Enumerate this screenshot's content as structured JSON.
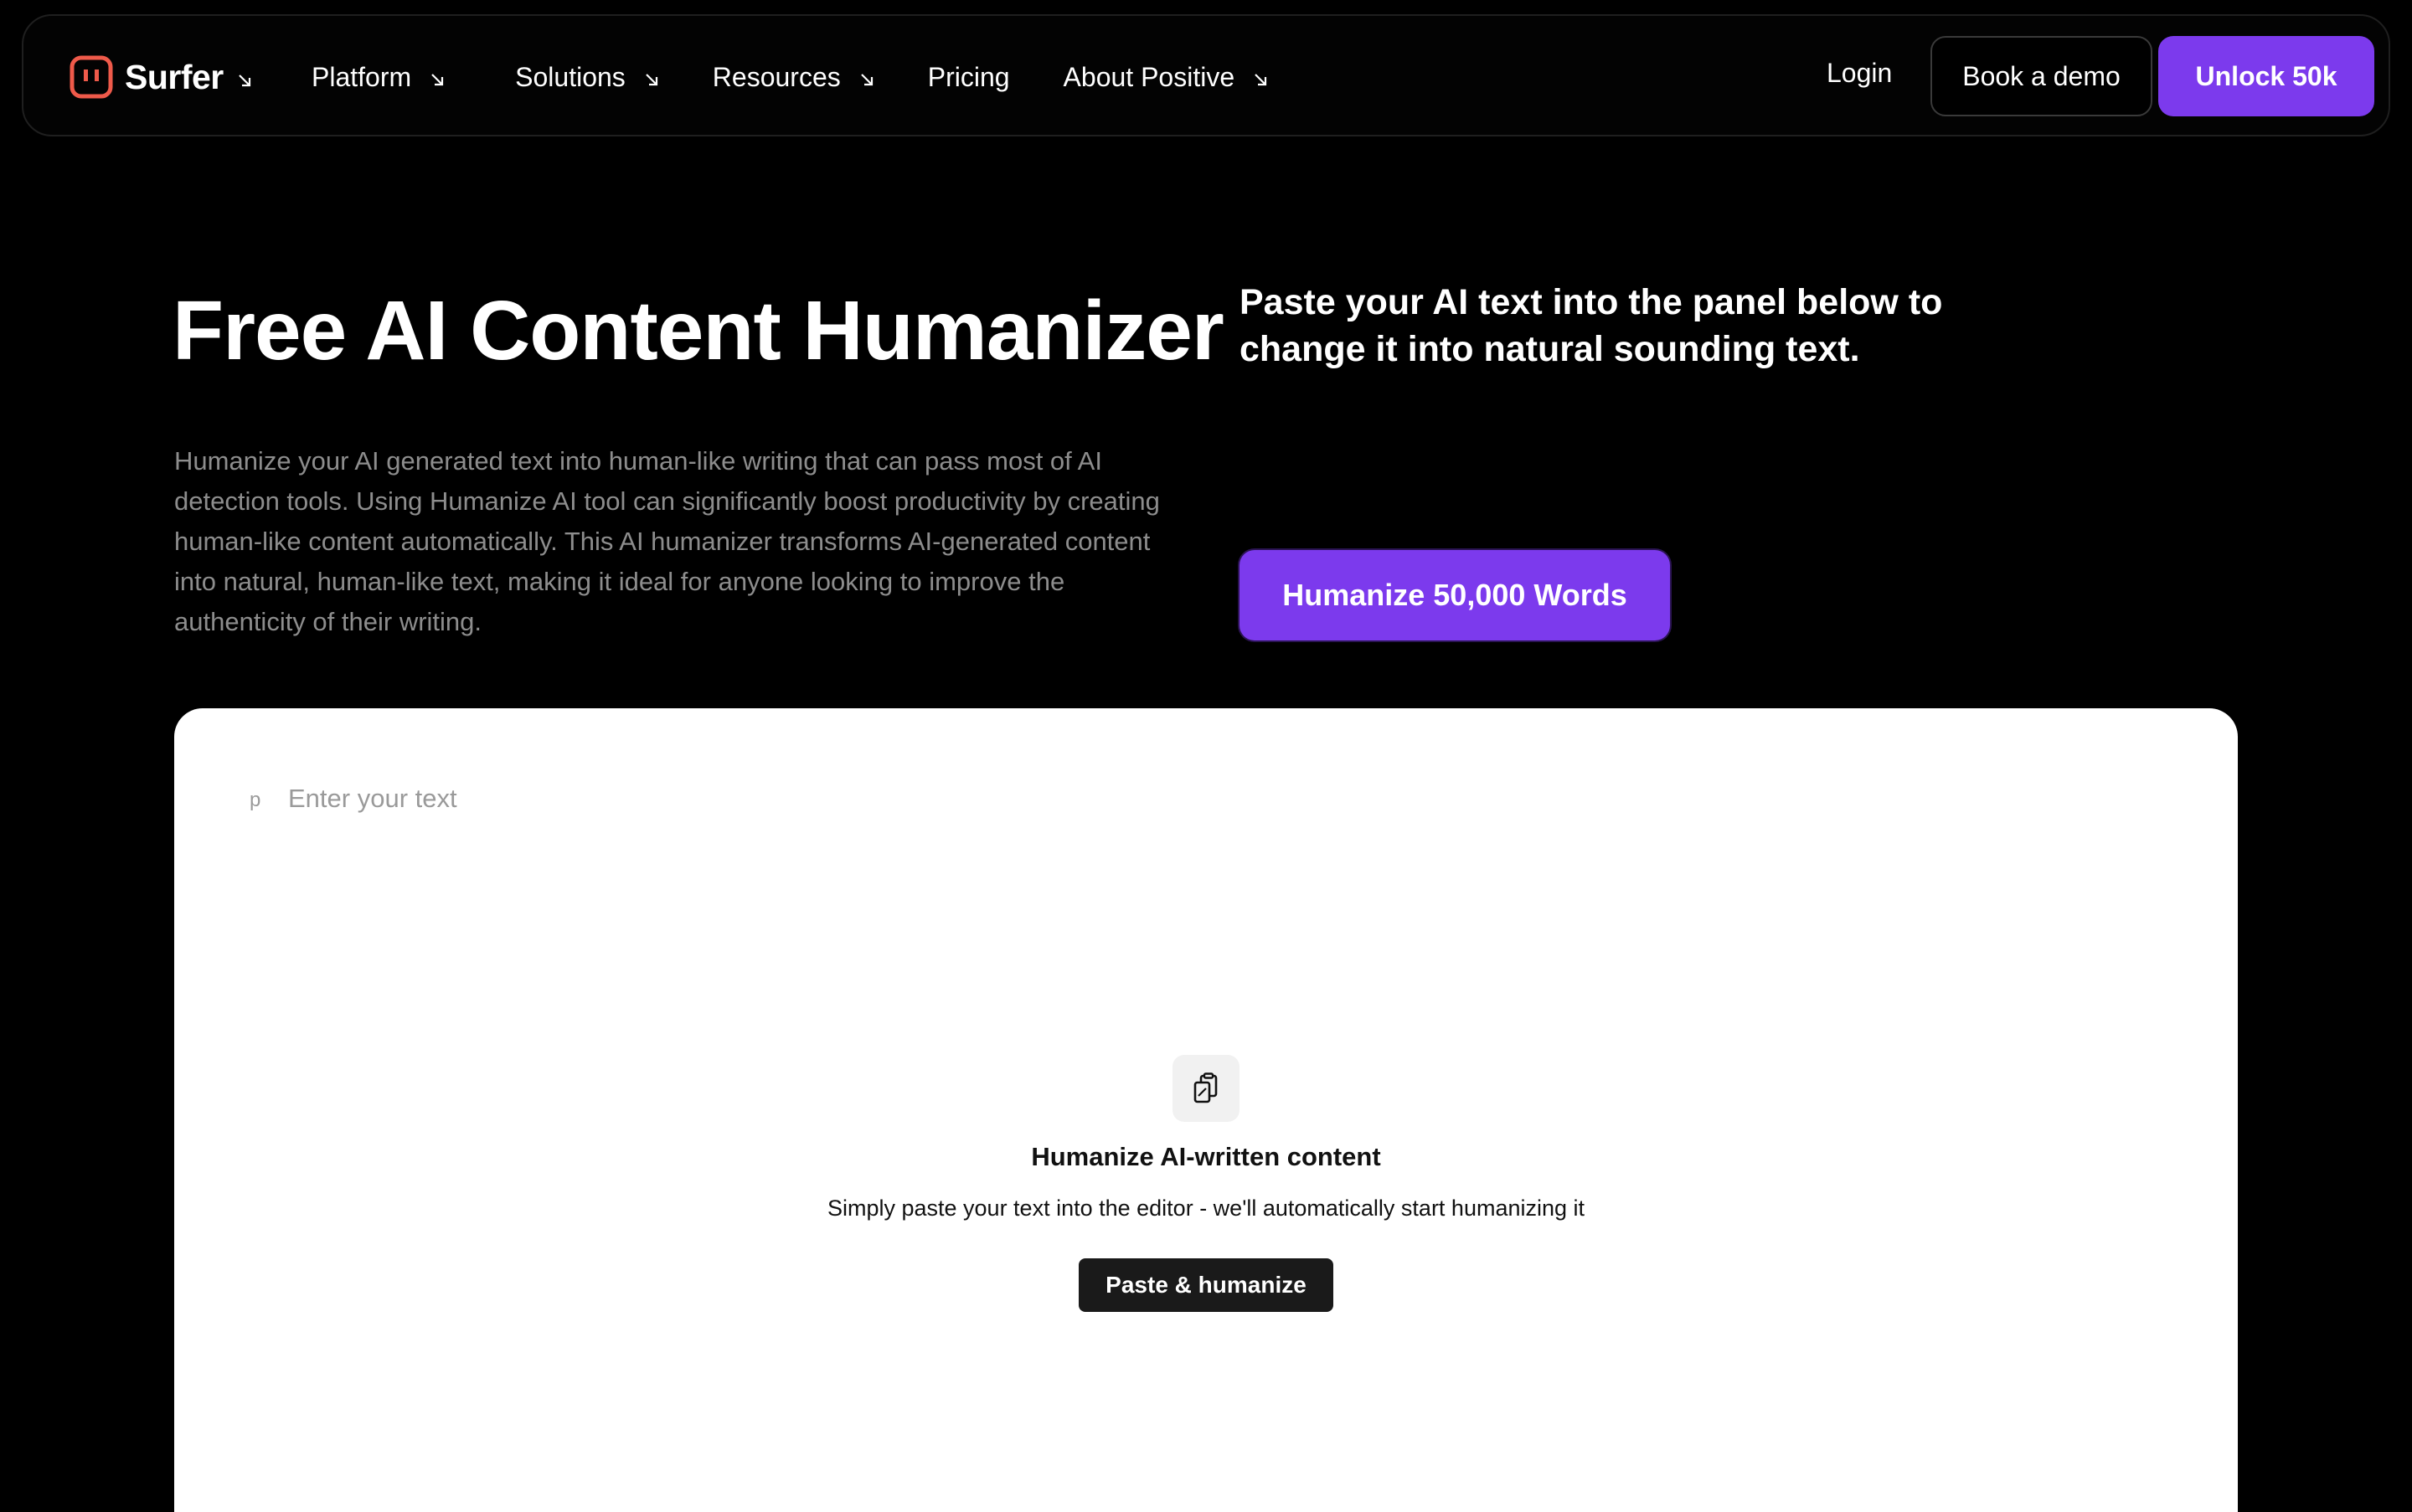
{
  "colors": {
    "background": "#000000",
    "accent": "#7c3aed",
    "logo": "#ef5a4a",
    "muted_text": "#8d8d8d",
    "panel": "#ffffff"
  },
  "nav": {
    "brand": "Surfer",
    "brand_icon": "surfer-logo-icon",
    "links": [
      "Platform",
      "Solutions",
      "Resources",
      "Pricing",
      "About Positive"
    ],
    "login": "Login",
    "demo_button": "Book a demo",
    "unlock_button": "Unlock 50k"
  },
  "hero": {
    "title": "Free AI Content Humanizer",
    "description": "Humanize your AI generated text into human-like writing that can pass most of AI detection tools. Using Humanize AI tool can significantly boost productivity by creating human-like content automatically. This AI humanizer transforms AI-generated content into natural, human-like text, making it ideal for anyone looking to improve the authenticity of their writing.",
    "subtitle": "Paste your AI text into the panel below to change it into natural sounding text.",
    "cta": "Humanize 50,000 Words"
  },
  "editor": {
    "paragraph_marker": "p",
    "placeholder": "Enter your text",
    "empty_icon": "clipboard-icon",
    "empty_title": "Humanize AI-written content",
    "empty_subtitle": "Simply paste your text into the editor - we'll automatically start humanizing it",
    "paste_button": "Paste & humanize"
  }
}
